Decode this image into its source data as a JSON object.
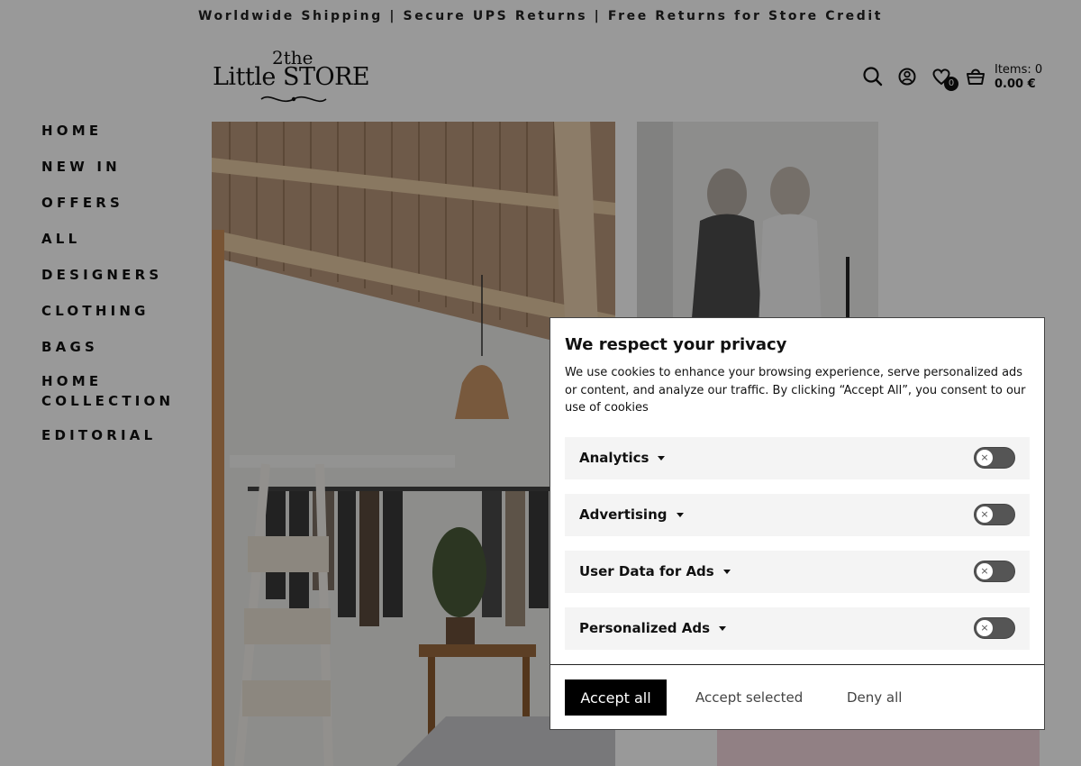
{
  "announcement": "Worldwide Shipping | Secure UPS Returns | Free Returns for Store Credit",
  "logo": {
    "top": "2the",
    "main": "Little STORE"
  },
  "header": {
    "wishlist_count": "0",
    "cart_items": "Items: 0",
    "cart_total": "0.00 €"
  },
  "nav": [
    "HOME",
    "NEW IN",
    "OFFERS",
    "ALL",
    "DESIGNERS",
    "CLOTHING",
    "BAGS",
    "HOME COLLECTION",
    "EDITORIAL"
  ],
  "cookie": {
    "title": "We respect your privacy",
    "description": "We use cookies to enhance your browsing experience, serve personalized ads or content, and analyze our traffic. By clicking “Accept All”, you consent to our use of cookies",
    "categories": [
      {
        "label": "Analytics",
        "enabled": false
      },
      {
        "label": "Advertising",
        "enabled": false
      },
      {
        "label": "User Data for Ads",
        "enabled": false
      },
      {
        "label": "Personalized Ads",
        "enabled": false
      }
    ],
    "accept_all": "Accept all",
    "accept_selected": "Accept selected",
    "deny_all": "Deny all"
  },
  "colors": {
    "overlay": "#00000066",
    "accent": "#000000"
  },
  "icons": [
    "search-icon",
    "account-icon",
    "heart-icon",
    "cart-basket-icon",
    "chevron-down-icon",
    "close-icon"
  ]
}
